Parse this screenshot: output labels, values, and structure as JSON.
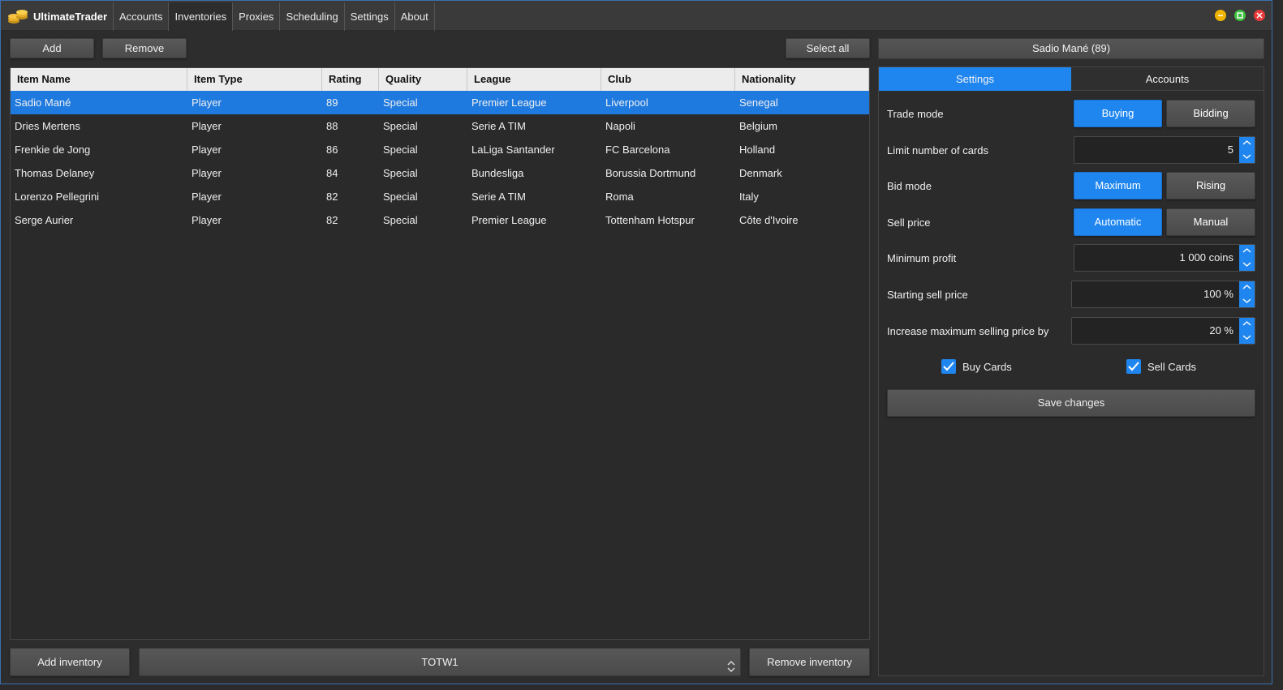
{
  "app": {
    "title": "UltimateTrader",
    "menu": [
      "Accounts",
      "Inventories",
      "Proxies",
      "Scheduling",
      "Settings",
      "About"
    ],
    "active_menu": "Inventories"
  },
  "toolbar": {
    "add_label": "Add",
    "remove_label": "Remove",
    "select_all_label": "Select all"
  },
  "table": {
    "columns": [
      "Item Name",
      "Item Type",
      "Rating",
      "Quality",
      "League",
      "Club",
      "Nationality"
    ],
    "rows": [
      [
        "Sadio Mané",
        "Player",
        "89",
        "Special",
        "Premier League",
        "Liverpool",
        "Senegal"
      ],
      [
        "Dries Mertens",
        "Player",
        "88",
        "Special",
        "Serie A TIM",
        "Napoli",
        "Belgium"
      ],
      [
        "Frenkie de Jong",
        "Player",
        "86",
        "Special",
        "LaLiga Santander",
        "FC Barcelona",
        "Holland"
      ],
      [
        "Thomas Delaney",
        "Player",
        "84",
        "Special",
        "Bundesliga",
        "Borussia Dortmund",
        "Denmark"
      ],
      [
        "Lorenzo Pellegrini",
        "Player",
        "82",
        "Special",
        "Serie A TIM",
        "Roma",
        "Italy"
      ],
      [
        "Serge Aurier",
        "Player",
        "82",
        "Special",
        "Premier League",
        "Tottenham Hotspur",
        "Côte d'Ivoire"
      ]
    ]
  },
  "bottom": {
    "add_inventory_label": "Add inventory",
    "inventory_selected": "TOTW1",
    "remove_inventory_label": "Remove inventory"
  },
  "right_panel": {
    "header": "Sadio Mané (89)",
    "tabs": [
      "Settings",
      "Accounts"
    ],
    "fields": {
      "trade_mode_label": "Trade mode",
      "trade_mode_options": [
        "Buying",
        "Bidding"
      ],
      "limit_label": "Limit number of cards",
      "limit_value": "5",
      "bid_mode_label": "Bid mode",
      "bid_mode_options": [
        "Maximum",
        "Rising"
      ],
      "sell_price_label": "Sell price",
      "sell_price_options": [
        "Automatic",
        "Manual"
      ],
      "min_profit_label": "Minimum profit",
      "min_profit_value": "1 000 coins",
      "start_sell_label": "Starting sell price",
      "start_sell_value": "100 %",
      "increase_label": "Increase maximum selling price by",
      "increase_value": "20 %"
    },
    "checkboxes": {
      "buy_cards_label": "Buy Cards",
      "buy_cards_checked": true,
      "sell_cards_label": "Sell Cards",
      "sell_cards_checked": true
    },
    "save_label": "Save changes"
  },
  "colors": {
    "accent": "#1f86f0",
    "selection": "#1f7ae0",
    "background": "#2d2d2d",
    "minimize": "#f0b400",
    "maximize": "#3fbf3f",
    "close": "#e83a3a"
  }
}
